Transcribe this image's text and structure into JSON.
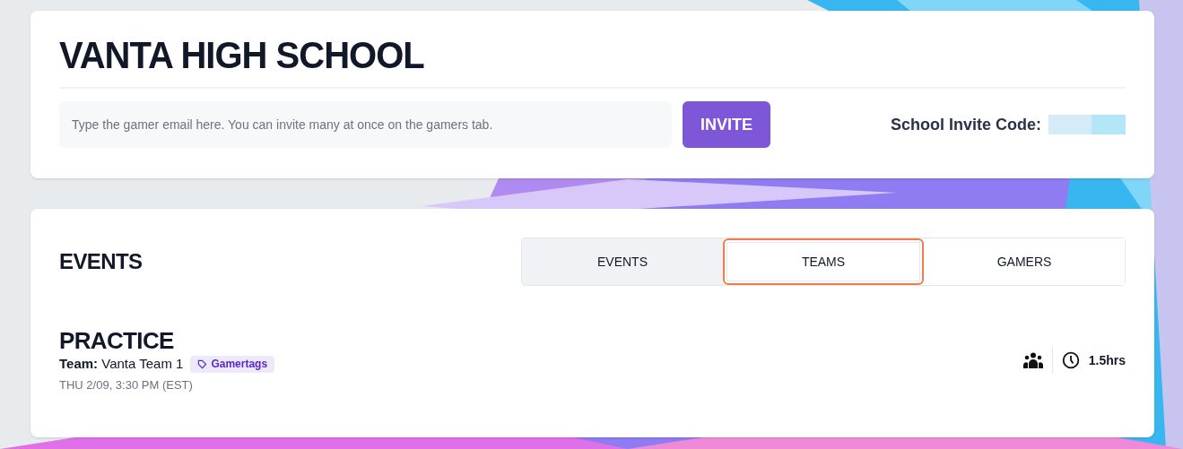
{
  "school": {
    "name": "VANTA HIGH SCHOOL",
    "invite_field": {
      "placeholder": "Type the gamer email here. You can invite many at once on the gamers tab."
    },
    "invite_button": "INVITE",
    "invite_code_label": "School Invite Code:"
  },
  "events_panel": {
    "title": "EVENTS",
    "tabs": [
      {
        "label": "EVENTS",
        "selected": true,
        "focused": false
      },
      {
        "label": "TEAMS",
        "selected": false,
        "focused": true
      },
      {
        "label": "GAMERS",
        "selected": false,
        "focused": false
      }
    ],
    "events": [
      {
        "title": "PRACTICE",
        "team_label": "Team:",
        "team": "Vanta Team 1",
        "tag": "Gamertags",
        "date": "THU 2/09, 3:30 PM (EST)",
        "duration": "1.5hrs"
      }
    ]
  }
}
